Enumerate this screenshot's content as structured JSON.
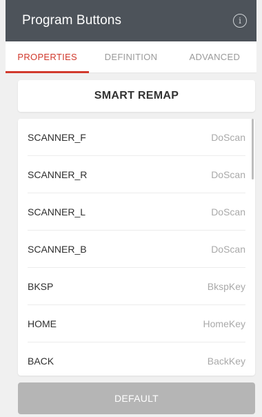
{
  "header": {
    "title": "Program Buttons",
    "info_icon": "info-icon"
  },
  "tabs": [
    {
      "label": "PROPERTIES",
      "active": true
    },
    {
      "label": "DEFINITION",
      "active": false
    },
    {
      "label": "ADVANCED",
      "active": false
    }
  ],
  "smart_remap_label": "SMART REMAP",
  "buttons": [
    {
      "key": "SCANNER_F",
      "value": "DoScan"
    },
    {
      "key": "SCANNER_R",
      "value": "DoScan"
    },
    {
      "key": "SCANNER_L",
      "value": "DoScan"
    },
    {
      "key": "SCANNER_B",
      "value": "DoScan"
    },
    {
      "key": "BKSP",
      "value": "BkspKey"
    },
    {
      "key": "HOME",
      "value": "HomeKey"
    },
    {
      "key": "BACK",
      "value": "BackKey"
    }
  ],
  "default_label": "DEFAULT",
  "colors": {
    "header_bg": "#4d535a",
    "accent": "#d1392c",
    "default_button_bg": "#b5b5b5"
  }
}
